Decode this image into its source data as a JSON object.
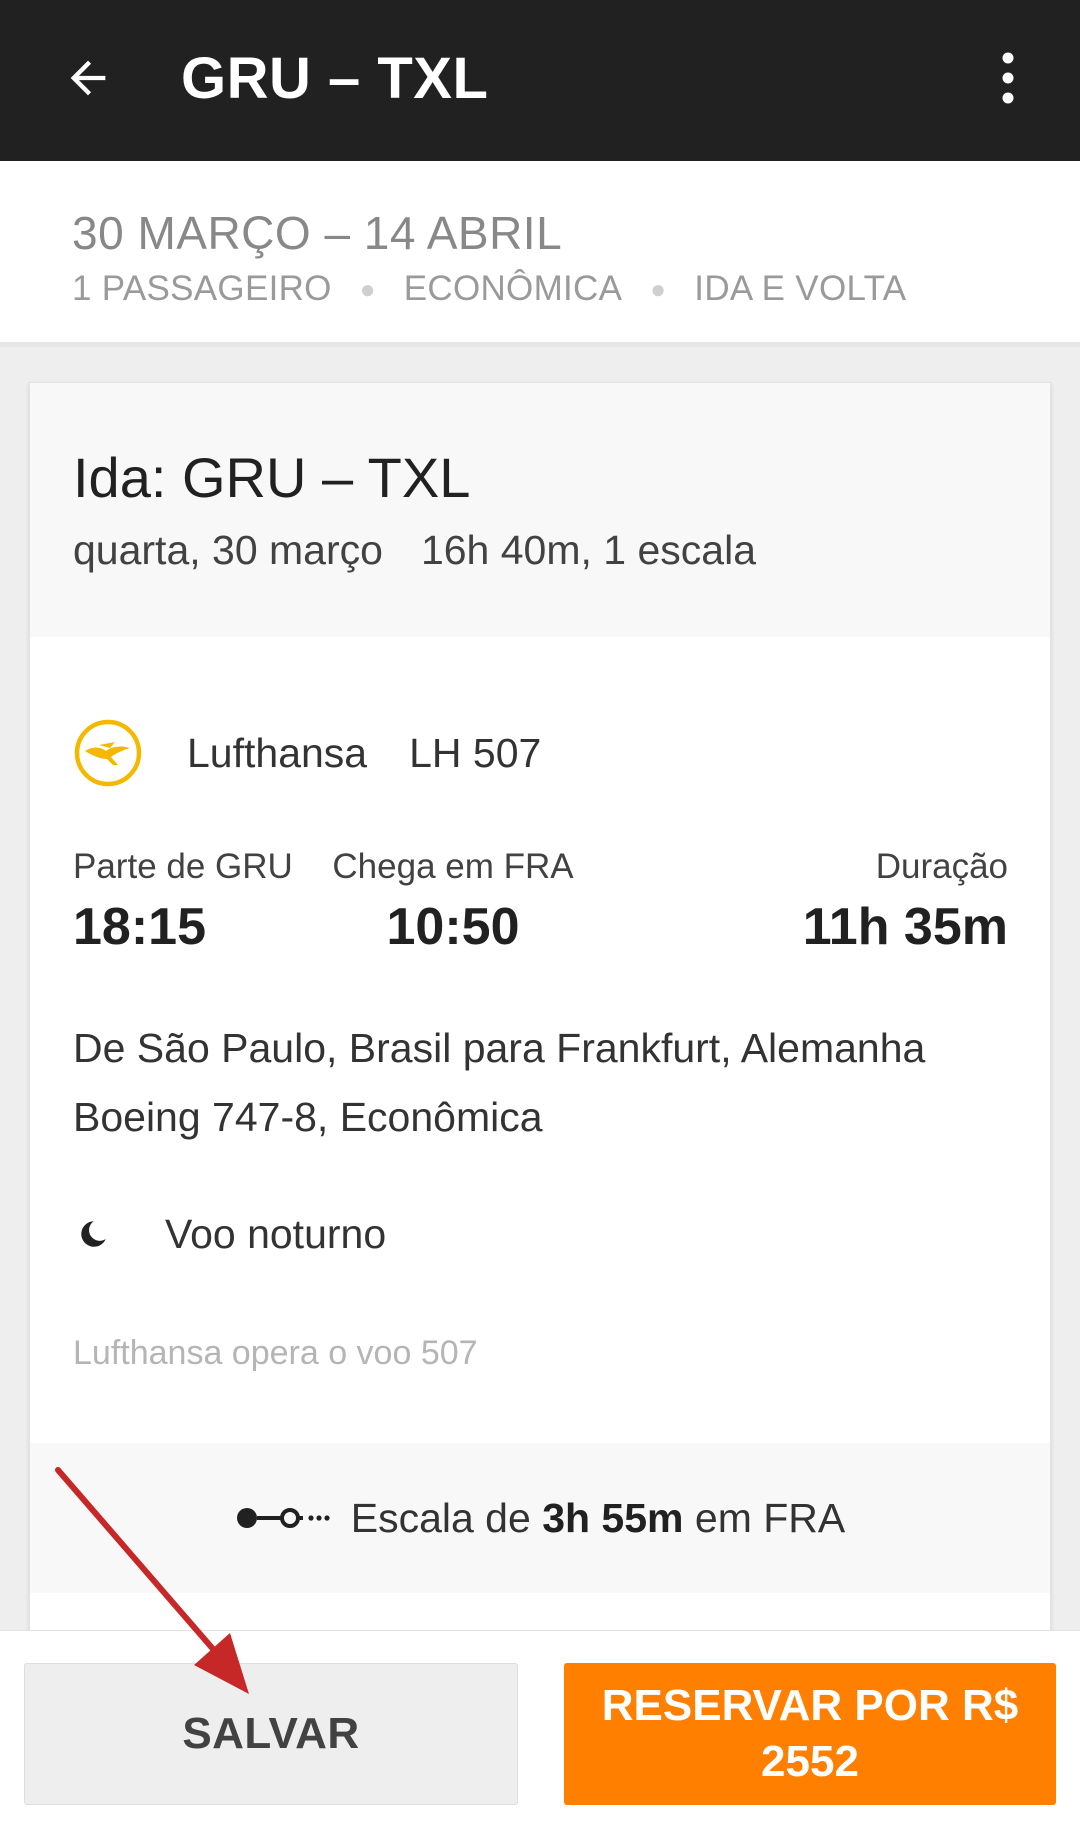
{
  "appbar": {
    "title": "GRU – TXL",
    "back_icon": "arrow-back-icon",
    "menu_icon": "more-vertical-icon"
  },
  "summary": {
    "dates": "30 MARÇO – 14 ABRIL",
    "passengers": "1 PASSAGEIRO",
    "cabin": "ECONÔMICA",
    "trip_type": "IDA E VOLTA"
  },
  "leg": {
    "title": "Ida: GRU – TXL",
    "date": "quarta, 30 março",
    "duration_stops": "16h 40m, 1 escala"
  },
  "segment": {
    "airline": "Lufthansa",
    "flight_number": "LH 507",
    "airline_logo": "lufthansa-crane-logo",
    "departure_label": "Parte de GRU",
    "departure_time": "18:15",
    "arrival_label": "Chega em FRA",
    "arrival_time": "10:50",
    "duration_label": "Duração",
    "duration": "11h 35m",
    "route": "De São Paulo, Brasil para Frankfurt, Alemanha",
    "aircraft": "Boeing 747-8, Econômica",
    "night_flight": "Voo noturno",
    "night_icon": "moon-icon",
    "operated_by": "Lufthansa opera o voo 507"
  },
  "layover": {
    "prefix": "Escala de ",
    "duration": "3h 55m",
    "suffix": " em FRA",
    "icon": "layover-connector-icon"
  },
  "actions": {
    "save_label": "SALVAR",
    "book_label": "RESERVAR POR R$ 2552"
  },
  "colors": {
    "appbar": "#212121",
    "book_button": "#ff7f00",
    "annotation_arrow": "#c62828",
    "lufthansa_yellow": "#f5b800"
  }
}
